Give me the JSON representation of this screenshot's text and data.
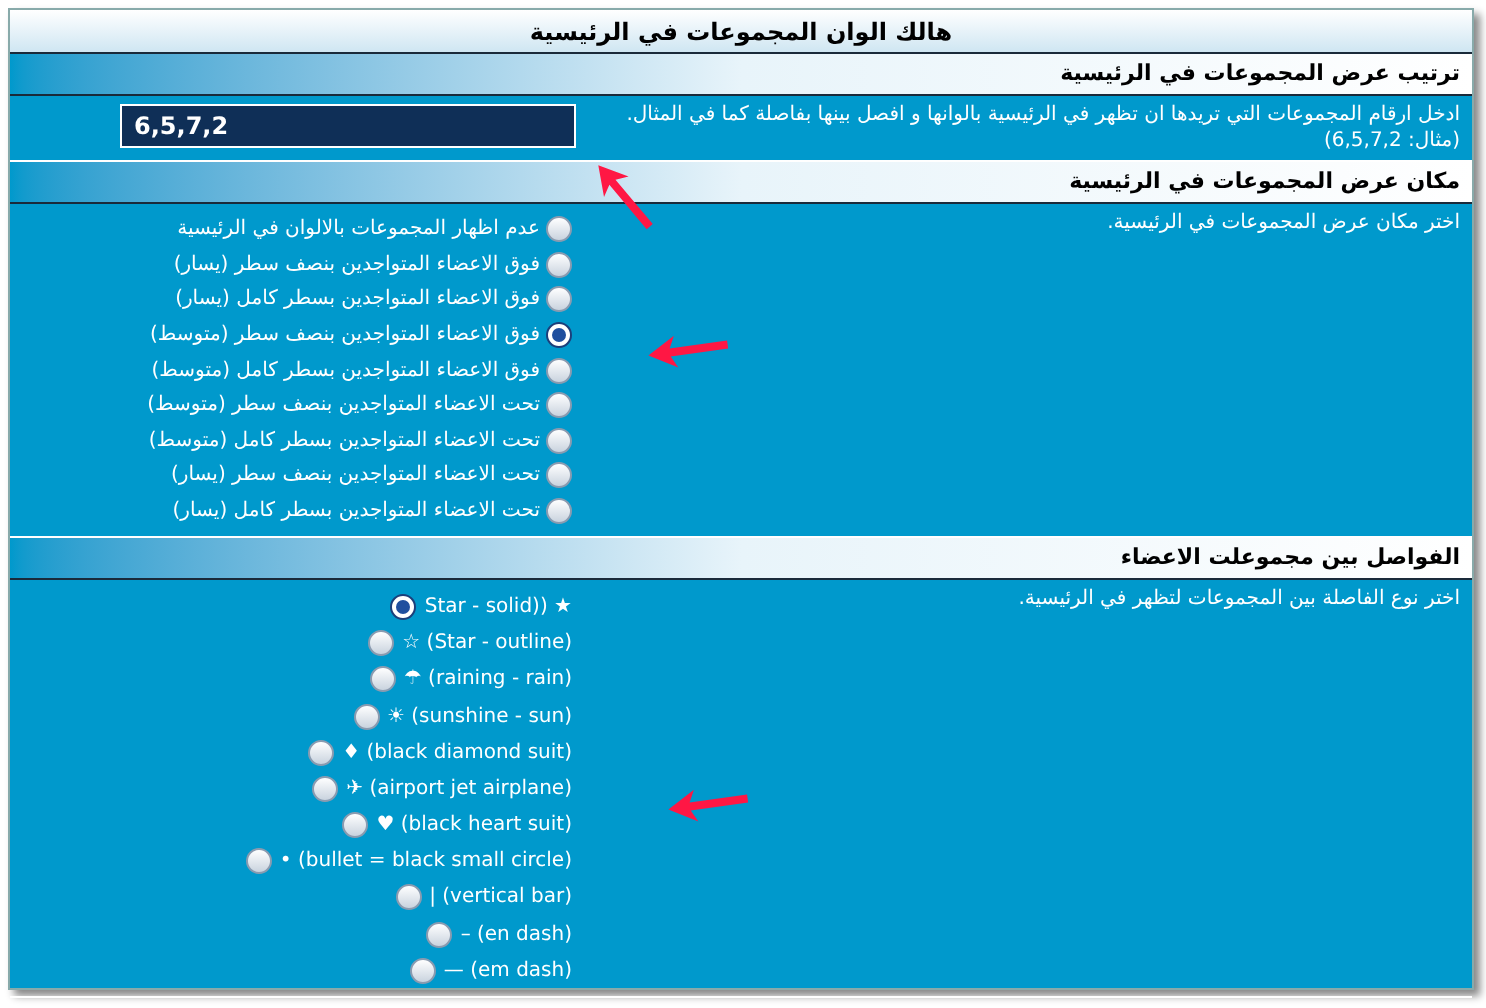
{
  "window": {
    "title": "هالك الوان المجموعات في الرئيسية"
  },
  "sections": [
    {
      "title": "ترتيب عرض المجموعات في الرئيسية",
      "kind": "input",
      "description": "ادخل ارقام المجموعات التي تريدها ان تظهر في الرئيسية بالوانها و افصل بينها بفاصلة كما في المثال. (مثال: 6,5,7,2)",
      "value": "6,5,7,2"
    },
    {
      "title": "مكان عرض المجموعات في الرئيسية",
      "kind": "radios",
      "description": "اختر مكان عرض المجموعات في الرئيسية.",
      "options": [
        {
          "label": "عدم اظهار المجموعات بالالوان في الرئيسية",
          "selected": false
        },
        {
          "label": "فوق الاعضاء المتواجدين بنصف سطر (يسار)",
          "selected": false
        },
        {
          "label": "فوق الاعضاء المتواجدين بسطر كامل (يسار)",
          "selected": false
        },
        {
          "label": "فوق الاعضاء المتواجدين بنصف سطر (متوسط)",
          "selected": true
        },
        {
          "label": "فوق الاعضاء المتواجدين بسطر كامل (متوسط)",
          "selected": false
        },
        {
          "label": "تحت الاعضاء المتواجدين بنصف سطر (متوسط)",
          "selected": false
        },
        {
          "label": "تحت الاعضاء المتواجدين بسطر كامل (متوسط)",
          "selected": false
        },
        {
          "label": "تحت الاعضاء المتواجدين بنصف سطر (يسار)",
          "selected": false
        },
        {
          "label": "تحت الاعضاء المتواجدين بسطر كامل (يسار)",
          "selected": false
        }
      ]
    },
    {
      "title": "الفواصل بين مجموعلت الاعضاء",
      "kind": "ltr-radios",
      "description": "اختر نوع الفاصلة بين المجموعات لتظهر في الرئيسية.",
      "options": [
        {
          "label": "Star - solid)) ★",
          "selected": true
        },
        {
          "label": "☆ (Star - outline)",
          "selected": false
        },
        {
          "label": "☂ (raining - rain)",
          "selected": false
        },
        {
          "label": "☀ (sunshine - sun)",
          "selected": false
        },
        {
          "label": "♦ (black diamond suit)",
          "selected": false
        },
        {
          "label": "✈ (airport jet airplane)",
          "selected": false
        },
        {
          "label": "♥ (black heart suit)",
          "selected": false
        },
        {
          "label": "• (bullet = black small circle)",
          "selected": false
        },
        {
          "label": "| (vertical bar)",
          "selected": false
        },
        {
          "label": "– (en dash)",
          "selected": false
        },
        {
          "label": "— (em dash)",
          "selected": false
        }
      ]
    }
  ]
}
